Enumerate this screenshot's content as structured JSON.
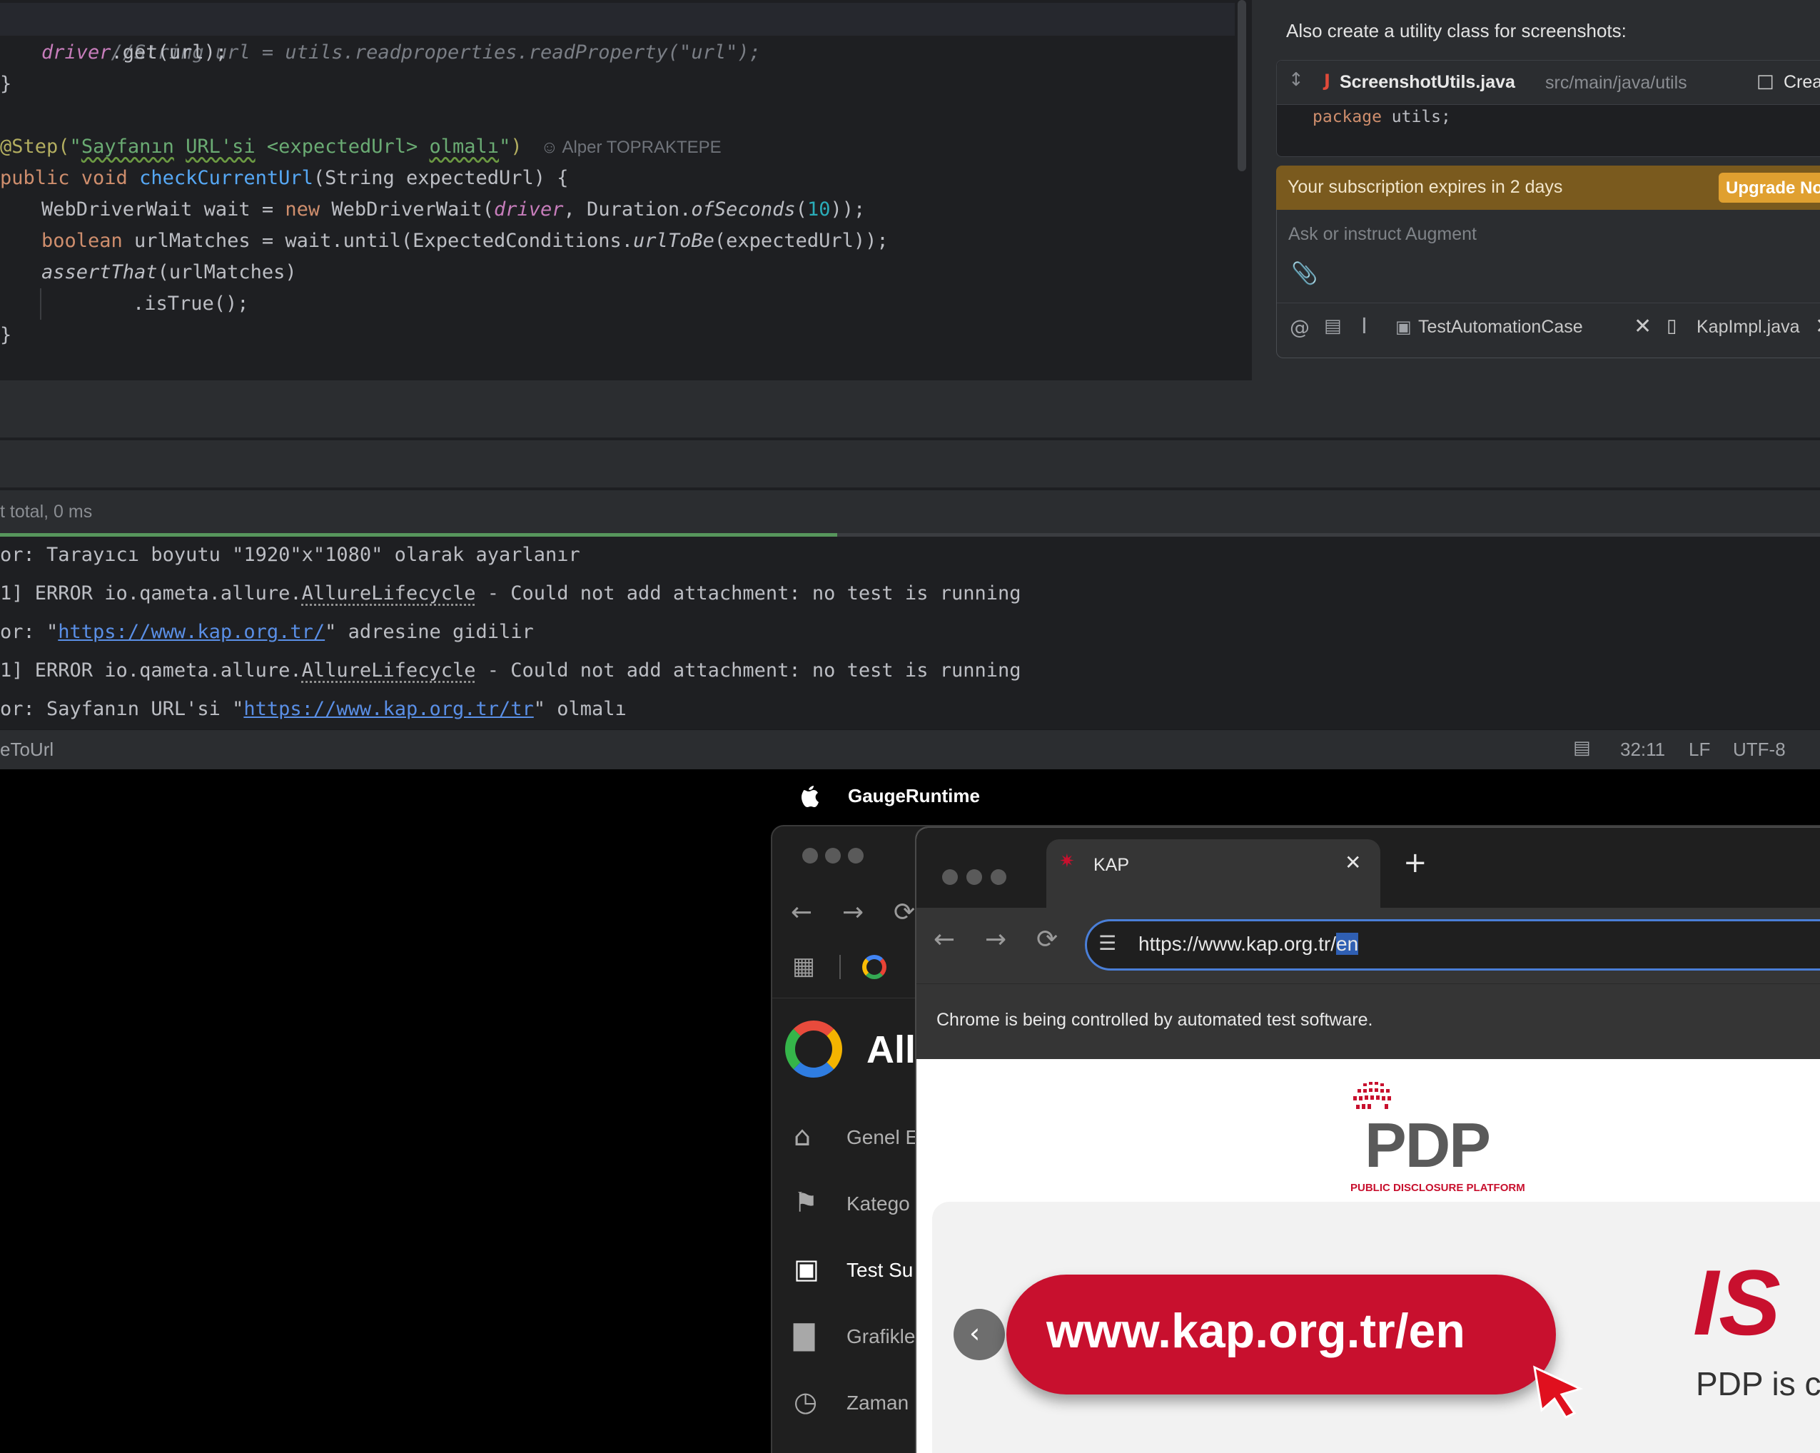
{
  "editor": {
    "lines": [
      {
        "kind": "comment",
        "text": "//String url = utils.readproperties.readProperty(\"url\");"
      },
      {
        "kind": "get",
        "field": "driver",
        "rest": ".get(url);"
      },
      {
        "kind": "brace",
        "text": "}"
      },
      {
        "kind": "step",
        "ann": "@Step(",
        "str_a": "\"",
        "str_b": "Sayfanın",
        "str_c": " ",
        "str_d": "URL'si",
        "str_e": " <expectedUrl> ",
        "str_f": "olmalı",
        "str_g": "\"",
        "close": ")",
        "author": "Alper TOPRAKTEPE"
      },
      {
        "kind": "sig",
        "kw": "public void ",
        "fn": "checkCurrentUrl",
        "rest": "(String expectedUrl) {"
      },
      {
        "kind": "wait",
        "a": "WebDriverWait wait = ",
        "kw": "new",
        "b": " WebDriverWait(",
        "field": "driver",
        "c": ", Duration.",
        "ital": "ofSeconds",
        "d": "(",
        "num": "10",
        "e": "));"
      },
      {
        "kind": "bool",
        "kw": "boolean",
        "a": " urlMatches = wait.until(ExpectedConditions.",
        "ital": "urlToBe",
        "b": "(expectedUrl));"
      },
      {
        "kind": "assert",
        "ital": "assertThat",
        "rest": "(urlMatches)"
      },
      {
        "kind": "istrue",
        "text": ".isTrue();"
      },
      {
        "kind": "brace",
        "text": "}"
      }
    ]
  },
  "augment": {
    "intro": "Also create a utility class for screenshots:",
    "file_name": "ScreenshotUtils.java",
    "file_path": "src/main/java/utils",
    "create_label": "Create",
    "code_kw": "package",
    "code_rest": " utils;",
    "subscription_text": "Your subscription expires in 2 days",
    "upgrade_label": "Upgrade No",
    "input_placeholder": "Ask or instruct Augment",
    "context_chips": [
      "TestAutomationCase",
      "KapImpl.java"
    ],
    "colors": {
      "banner": "#7a5a1e",
      "upgrade": "#e0a030"
    }
  },
  "run": {
    "summary": "t total, 0 ms",
    "progress_fraction": 0.46,
    "progress_color": "#57965c"
  },
  "console": {
    "lines": [
      {
        "parts": [
          {
            "t": "or: Tarayıcı boyutu \"1920\"x\"1080\" olarak ayarlanır"
          }
        ]
      },
      {
        "parts": [
          {
            "t": "1] ERROR io.qameta.allure."
          },
          {
            "t": "AllureLifecycle",
            "c": "dotted"
          },
          {
            "t": " - Could not add attachment: no test is running"
          }
        ]
      },
      {
        "parts": [
          {
            "t": "or: \""
          },
          {
            "t": "https://www.kap.org.tr/",
            "c": "link"
          },
          {
            "t": "\" adresine gidilir"
          }
        ]
      },
      {
        "parts": [
          {
            "t": "1] ERROR io.qameta.allure."
          },
          {
            "t": "AllureLifecycle",
            "c": "dotted"
          },
          {
            "t": " - Could not add attachment: no test is running"
          }
        ]
      },
      {
        "parts": [
          {
            "t": "or: Sayfanın URL'si \""
          },
          {
            "t": "https://www.kap.org.tr/tr",
            "c": "link"
          },
          {
            "t": "\" olmalı"
          }
        ]
      }
    ]
  },
  "statusbar": {
    "left": "eToUrl",
    "position": "32:11",
    "line_sep": "LF",
    "encoding": "UTF-8"
  },
  "menubar": {
    "app_name": "GaugeRuntime"
  },
  "back_window": {
    "title_partial": "All",
    "nav_items": [
      "Genel E",
      "Katego",
      "Test Su",
      "Grafikle",
      "Zaman"
    ],
    "active_index": 2
  },
  "chrome": {
    "tab_title": "KAP",
    "url_base": "https://www.kap.org.tr/",
    "url_selected": "en",
    "automation_notice": "Chrome is being controlled by automated test software.",
    "logo_text": "PDP",
    "logo_subtitle": "PUBLIC DISCLOSURE PLATFORM",
    "banner_url": "www.kap.org.tr/en",
    "banner_right_big": "IS",
    "banner_right_small": "PDP is c",
    "colors": {
      "brand_red": "#c8102e",
      "accent_blue": "#4a7fd8"
    }
  }
}
